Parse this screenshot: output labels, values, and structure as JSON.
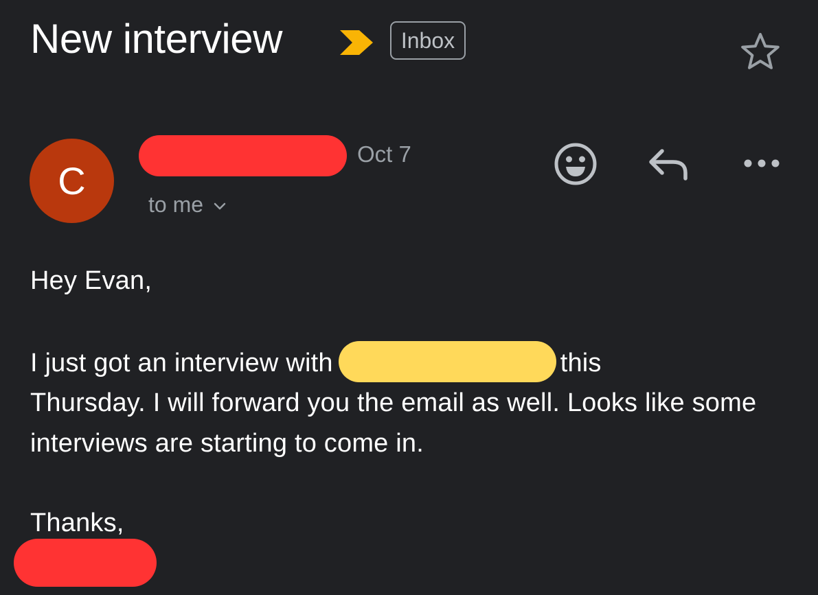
{
  "header": {
    "subject": "New interview",
    "label": "Inbox",
    "importance_color": "#f9b405",
    "importance_icon": "importance-marker-icon",
    "star_icon": "star-outline-icon"
  },
  "message": {
    "avatar_letter": "C",
    "avatar_color": "#b9380d",
    "sender_redacted": true,
    "date": "Oct 7",
    "recipients": "to me",
    "actions": {
      "emoji_icon": "smiley-icon",
      "reply_icon": "reply-icon",
      "more_icon": "more-horizontal-icon"
    },
    "body": {
      "greeting": "Hey Evan,",
      "line1_before": "I just got an interview with",
      "line1_after": "this",
      "rest": "Thursday. I will forward you the email as well. Looks like some interviews are starting to come in.",
      "closing": "Thanks,"
    },
    "redaction_colors": {
      "sender": "#ff3333",
      "company": "#ffd95a",
      "signature": "#ff3333"
    }
  }
}
